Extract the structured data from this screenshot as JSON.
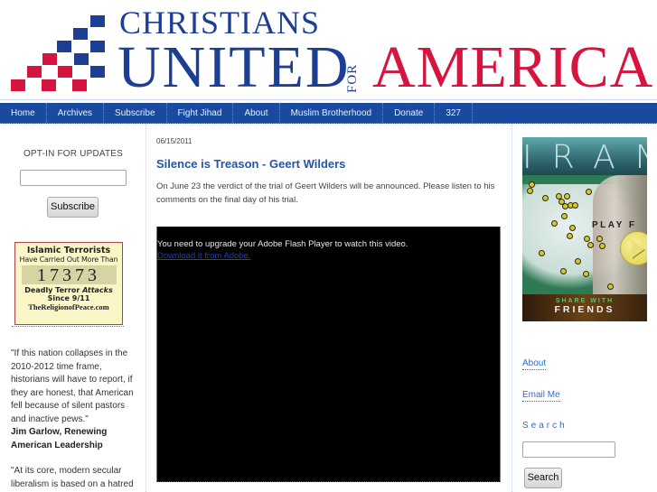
{
  "header": {
    "logo_line1": "CHRISTIANS",
    "logo_line2": "UNITED",
    "logo_for": "FOR",
    "logo_line3": "AMERICA",
    "colors": {
      "blue": "#1c3f94",
      "red": "#d5153f"
    }
  },
  "nav": {
    "items": [
      {
        "label": "Home"
      },
      {
        "label": "Archives"
      },
      {
        "label": "Subscribe"
      },
      {
        "label": "Fight Jihad"
      },
      {
        "label": "About"
      },
      {
        "label": "Muslim Brotherhood"
      },
      {
        "label": "Donate"
      },
      {
        "label": "327"
      }
    ],
    "background": "#1a4aa0"
  },
  "left_sidebar": {
    "optin_title": "OPT-IN FOR UPDATES",
    "optin_input_value": "",
    "optin_button": "Subscribe",
    "terror_widget": {
      "line1": "Islamic Terrorists",
      "line2": "Have Carried Out More Than",
      "count": "17373",
      "line3_prefix": "Deadly Terror ",
      "line3_italic": "Attacks",
      "line4": "Since 9/11",
      "line5": "TheReligionofPeace.com"
    },
    "quote1": "\"If this nation collapses in the 2010-2012 time frame, historians will have to report, if they are honest, that American fell because of silent pastors and inactive pews.\"",
    "quote1_author": "Jim Garlow, Renewing American Leadership",
    "quote2": "\"At its core, modern secular liberalism is based on a hatred"
  },
  "post": {
    "date": "06/15/2011",
    "title": "Silence is Treason - Geert Wilders",
    "body": "On June 23 the verdict of the trial of Geert Wilders will be announced.  Please listen to his comments on the final day of his trial.",
    "video": {
      "message": "You need to upgrade your Adobe Flash Player to watch this video.",
      "link": "Download it from Adobe."
    }
  },
  "right_sidebar": {
    "ad": {
      "title": "IRAN",
      "play_text": "PLAY F",
      "share_with": "SHARE WITH",
      "friends": "FRIENDS"
    },
    "links": [
      {
        "label": "About"
      },
      {
        "label": "Email Me"
      }
    ],
    "search_title": "Search",
    "search_input_value": "",
    "search_button": "Search"
  }
}
